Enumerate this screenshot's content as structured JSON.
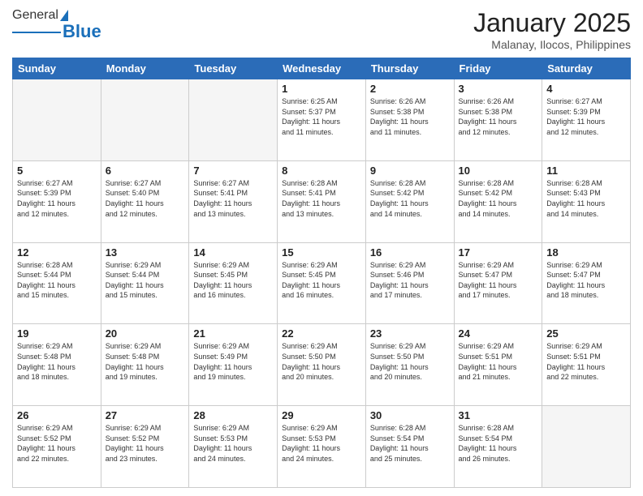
{
  "logo": {
    "general": "General",
    "blue": "Blue"
  },
  "header": {
    "month": "January 2025",
    "location": "Malanay, Ilocos, Philippines"
  },
  "days": [
    "Sunday",
    "Monday",
    "Tuesday",
    "Wednesday",
    "Thursday",
    "Friday",
    "Saturday"
  ],
  "weeks": [
    [
      {
        "day": "",
        "info": ""
      },
      {
        "day": "",
        "info": ""
      },
      {
        "day": "",
        "info": ""
      },
      {
        "day": "1",
        "info": "Sunrise: 6:25 AM\nSunset: 5:37 PM\nDaylight: 11 hours\nand 11 minutes."
      },
      {
        "day": "2",
        "info": "Sunrise: 6:26 AM\nSunset: 5:38 PM\nDaylight: 11 hours\nand 11 minutes."
      },
      {
        "day": "3",
        "info": "Sunrise: 6:26 AM\nSunset: 5:38 PM\nDaylight: 11 hours\nand 12 minutes."
      },
      {
        "day": "4",
        "info": "Sunrise: 6:27 AM\nSunset: 5:39 PM\nDaylight: 11 hours\nand 12 minutes."
      }
    ],
    [
      {
        "day": "5",
        "info": "Sunrise: 6:27 AM\nSunset: 5:39 PM\nDaylight: 11 hours\nand 12 minutes."
      },
      {
        "day": "6",
        "info": "Sunrise: 6:27 AM\nSunset: 5:40 PM\nDaylight: 11 hours\nand 12 minutes."
      },
      {
        "day": "7",
        "info": "Sunrise: 6:27 AM\nSunset: 5:41 PM\nDaylight: 11 hours\nand 13 minutes."
      },
      {
        "day": "8",
        "info": "Sunrise: 6:28 AM\nSunset: 5:41 PM\nDaylight: 11 hours\nand 13 minutes."
      },
      {
        "day": "9",
        "info": "Sunrise: 6:28 AM\nSunset: 5:42 PM\nDaylight: 11 hours\nand 14 minutes."
      },
      {
        "day": "10",
        "info": "Sunrise: 6:28 AM\nSunset: 5:42 PM\nDaylight: 11 hours\nand 14 minutes."
      },
      {
        "day": "11",
        "info": "Sunrise: 6:28 AM\nSunset: 5:43 PM\nDaylight: 11 hours\nand 14 minutes."
      }
    ],
    [
      {
        "day": "12",
        "info": "Sunrise: 6:28 AM\nSunset: 5:44 PM\nDaylight: 11 hours\nand 15 minutes."
      },
      {
        "day": "13",
        "info": "Sunrise: 6:29 AM\nSunset: 5:44 PM\nDaylight: 11 hours\nand 15 minutes."
      },
      {
        "day": "14",
        "info": "Sunrise: 6:29 AM\nSunset: 5:45 PM\nDaylight: 11 hours\nand 16 minutes."
      },
      {
        "day": "15",
        "info": "Sunrise: 6:29 AM\nSunset: 5:45 PM\nDaylight: 11 hours\nand 16 minutes."
      },
      {
        "day": "16",
        "info": "Sunrise: 6:29 AM\nSunset: 5:46 PM\nDaylight: 11 hours\nand 17 minutes."
      },
      {
        "day": "17",
        "info": "Sunrise: 6:29 AM\nSunset: 5:47 PM\nDaylight: 11 hours\nand 17 minutes."
      },
      {
        "day": "18",
        "info": "Sunrise: 6:29 AM\nSunset: 5:47 PM\nDaylight: 11 hours\nand 18 minutes."
      }
    ],
    [
      {
        "day": "19",
        "info": "Sunrise: 6:29 AM\nSunset: 5:48 PM\nDaylight: 11 hours\nand 18 minutes."
      },
      {
        "day": "20",
        "info": "Sunrise: 6:29 AM\nSunset: 5:48 PM\nDaylight: 11 hours\nand 19 minutes."
      },
      {
        "day": "21",
        "info": "Sunrise: 6:29 AM\nSunset: 5:49 PM\nDaylight: 11 hours\nand 19 minutes."
      },
      {
        "day": "22",
        "info": "Sunrise: 6:29 AM\nSunset: 5:50 PM\nDaylight: 11 hours\nand 20 minutes."
      },
      {
        "day": "23",
        "info": "Sunrise: 6:29 AM\nSunset: 5:50 PM\nDaylight: 11 hours\nand 20 minutes."
      },
      {
        "day": "24",
        "info": "Sunrise: 6:29 AM\nSunset: 5:51 PM\nDaylight: 11 hours\nand 21 minutes."
      },
      {
        "day": "25",
        "info": "Sunrise: 6:29 AM\nSunset: 5:51 PM\nDaylight: 11 hours\nand 22 minutes."
      }
    ],
    [
      {
        "day": "26",
        "info": "Sunrise: 6:29 AM\nSunset: 5:52 PM\nDaylight: 11 hours\nand 22 minutes."
      },
      {
        "day": "27",
        "info": "Sunrise: 6:29 AM\nSunset: 5:52 PM\nDaylight: 11 hours\nand 23 minutes."
      },
      {
        "day": "28",
        "info": "Sunrise: 6:29 AM\nSunset: 5:53 PM\nDaylight: 11 hours\nand 24 minutes."
      },
      {
        "day": "29",
        "info": "Sunrise: 6:29 AM\nSunset: 5:53 PM\nDaylight: 11 hours\nand 24 minutes."
      },
      {
        "day": "30",
        "info": "Sunrise: 6:28 AM\nSunset: 5:54 PM\nDaylight: 11 hours\nand 25 minutes."
      },
      {
        "day": "31",
        "info": "Sunrise: 6:28 AM\nSunset: 5:54 PM\nDaylight: 11 hours\nand 26 minutes."
      },
      {
        "day": "",
        "info": ""
      }
    ]
  ]
}
